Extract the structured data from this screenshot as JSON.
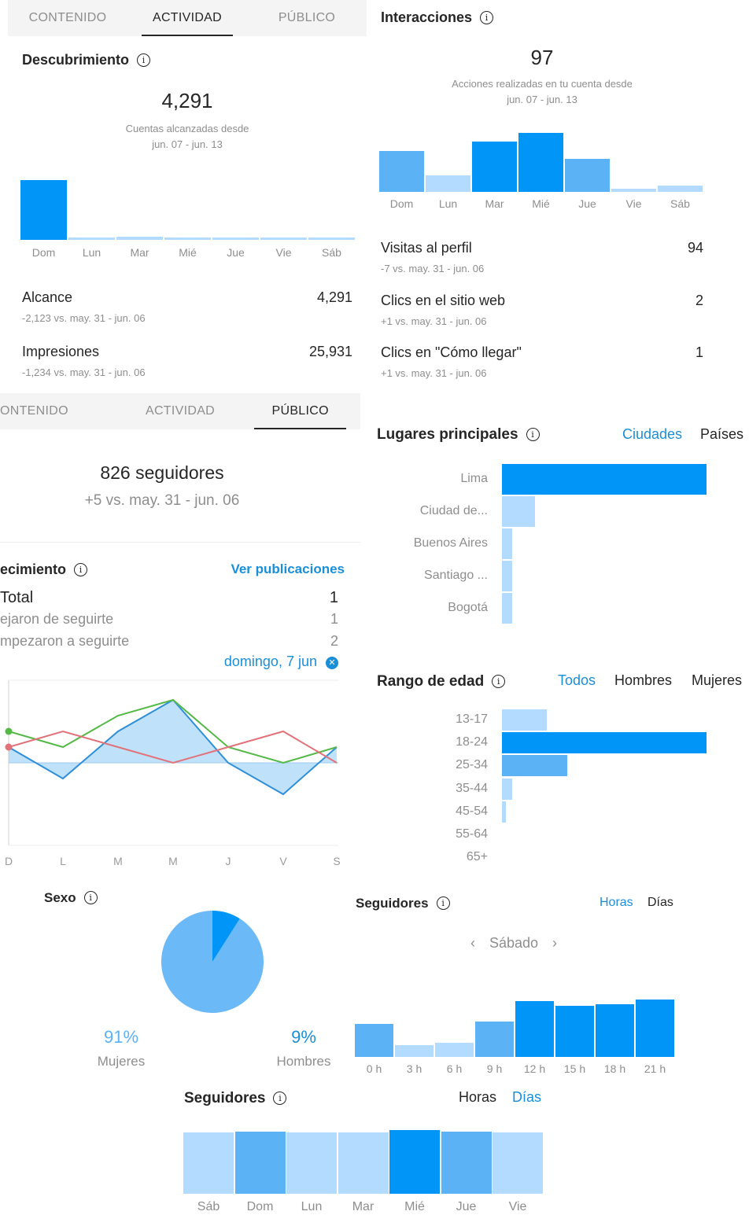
{
  "colors": {
    "dark_bar": "#0095f6",
    "mid_bar": "#5bb2f5",
    "light_bar": "#b3dbff",
    "accent": "#1a8fd8",
    "text": "#262626",
    "muted": "#8e8e8e"
  },
  "actividad_tabs": {
    "contenido": "CONTENIDO",
    "actividad": "ACTIVIDAD",
    "publico": "PÚBLICO"
  },
  "descubrimiento": {
    "title": "Descubrimiento",
    "value": "4,291",
    "sub1": "Cuentas alcanzadas desde",
    "sub2": "jun. 07 - jun. 13",
    "days": [
      "Dom",
      "Lun",
      "Mar",
      "Mié",
      "Jue",
      "Vie",
      "Sáb"
    ],
    "bars": [
      4291,
      150,
      200,
      180,
      130,
      90,
      140
    ],
    "alcance": {
      "label": "Alcance",
      "value": "4,291",
      "delta": "-2,123 vs. may. 31 - jun. 06"
    },
    "impresiones": {
      "label": "Impresiones",
      "value": "25,931",
      "delta": "-1,234 vs. may. 31 - jun. 06"
    }
  },
  "interacciones": {
    "title": "Interacciones",
    "value": "97",
    "sub1": "Acciones realizadas en tu cuenta desde",
    "sub2": "jun. 07 - jun. 13",
    "days": [
      "Dom",
      "Lun",
      "Mar",
      "Mié",
      "Jue",
      "Vie",
      "Sáb"
    ],
    "bars": [
      0.7,
      0.28,
      0.85,
      1.0,
      0.56,
      0.06,
      0.11
    ],
    "visitas": {
      "label": "Visitas al perfil",
      "value": "94",
      "delta": "-7 vs. may. 31 - jun. 06"
    },
    "clics_web": {
      "label": "Clics en el sitio web",
      "value": "2",
      "delta": "+1 vs. may. 31 - jun. 06"
    },
    "clics_llegar": {
      "label": "Clics en \"Cómo llegar\"",
      "value": "1",
      "delta": "+1 vs. may. 31 - jun. 06"
    }
  },
  "publico_tabs": {
    "contenido": "ONTENIDO",
    "actividad": "ACTIVIDAD",
    "publico": "PÚBLICO"
  },
  "seguidores_total": {
    "count": "826 seguidores",
    "delta": "+5 vs. may. 31 - jun. 06"
  },
  "crecimiento": {
    "title": "ecimiento",
    "link": "Ver publicaciones",
    "total_label": "Total",
    "total_value": "1",
    "dejaron_label": "ejaron de seguirte",
    "dejaron_value": "1",
    "empezaron_label": "mpezaron a seguirte",
    "empezaron_value": "2",
    "selected_day": "domingo, 7 jun",
    "days": [
      "D",
      "L",
      "M",
      "M",
      "J",
      "V",
      "S"
    ],
    "chart_data": {
      "type": "line",
      "x": [
        "D",
        "L",
        "M",
        "M",
        "J",
        "V",
        "S"
      ],
      "series": [
        {
          "values": [
            1,
            -1,
            2,
            4,
            0,
            -2,
            1
          ],
          "color": "#2f8fd8"
        },
        {
          "values": [
            2,
            1,
            3,
            4,
            1,
            0,
            1
          ],
          "color": "#55b948"
        },
        {
          "values": [
            1,
            2,
            1,
            0,
            1,
            2,
            0
          ],
          "color": "#e2727a"
        }
      ]
    }
  },
  "lugares": {
    "title": "Lugares principales",
    "tab_ciudades": "Ciudades",
    "tab_paises": "Países",
    "chart_data": {
      "type": "bar",
      "categories": [
        "Lima",
        "Ciudad de...",
        "Buenos Aires",
        "Santiago ...",
        "Bogotá"
      ],
      "values": [
        100,
        16,
        5,
        5,
        5
      ]
    }
  },
  "rango_edad": {
    "title": "Rango de edad",
    "tab_todos": "Todos",
    "tab_hombres": "Hombres",
    "tab_mujeres": "Mujeres",
    "chart_data": {
      "type": "bar",
      "categories": [
        "13-17",
        "18-24",
        "25-34",
        "35-44",
        "45-54",
        "55-64",
        "65+"
      ],
      "values": [
        22,
        100,
        32,
        5,
        2,
        0,
        0
      ]
    }
  },
  "sexo": {
    "title": "Sexo",
    "chart_data": {
      "type": "pie",
      "categories": [
        "Mujeres",
        "Hombres"
      ],
      "values": [
        91,
        9
      ]
    },
    "mujeres_pct": "91%",
    "mujeres_label": "Mujeres",
    "hombres_pct": "9%",
    "hombres_label": "Hombres"
  },
  "seguidores_horas": {
    "title": "Seguidores",
    "tab_horas": "Horas",
    "tab_dias": "Días",
    "day_label": "Sábado",
    "chart_data": {
      "type": "bar",
      "categories": [
        "0 h",
        "3 h",
        "6 h",
        "9 h",
        "12 h",
        "15 h",
        "18 h",
        "21 h"
      ],
      "values": [
        59,
        21,
        25,
        63,
        100,
        92,
        95,
        103
      ]
    }
  },
  "seguidores_dias": {
    "title": "Seguidores",
    "tab_horas": "Horas",
    "tab_dias": "Días",
    "chart_data": {
      "type": "bar",
      "categories": [
        "Sáb",
        "Dom",
        "Lun",
        "Mar",
        "Mié",
        "Jue",
        "Vie"
      ],
      "values": [
        96,
        98,
        96,
        96,
        100,
        98,
        96
      ]
    }
  }
}
